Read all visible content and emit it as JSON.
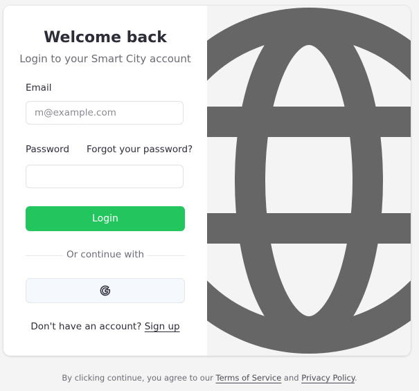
{
  "login": {
    "title": "Welcome back",
    "subtitle": "Login to your Smart City account",
    "email_label": "Email",
    "email_placeholder": "m@example.com",
    "email_value": "",
    "password_label": "Password",
    "password_value": "",
    "forgot_link": "Forgot your password?",
    "login_button": "Login",
    "divider_text": "Or continue with",
    "google_icon": "google-g-icon",
    "signup_prompt": "Don't have an account?",
    "signup_link": "Sign up"
  },
  "illustration": {
    "icon": "globe-icon"
  },
  "footer": {
    "prefix": "By clicking continue, you agree to our",
    "terms_link": "Terms of Service",
    "and_text": "and",
    "privacy_link": "Privacy Policy",
    "suffix": "."
  },
  "colors": {
    "accent": "#22c55e",
    "text": "#2d2d3a",
    "muted": "#6b6b76",
    "globe": "#666666",
    "panel_bg": "#f4f4f4"
  }
}
